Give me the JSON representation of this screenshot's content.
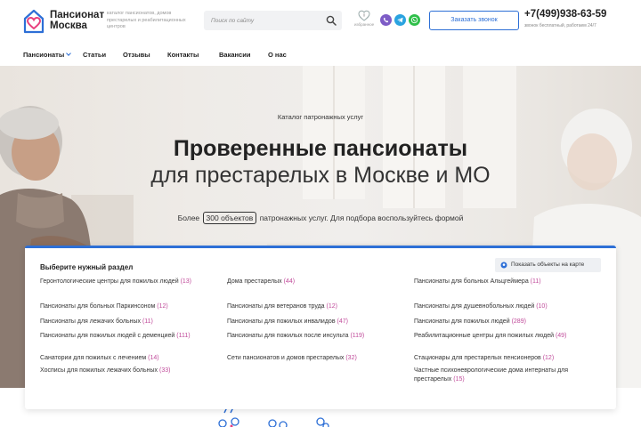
{
  "header": {
    "logo_line1": "Пансионат",
    "logo_line2": "Москва",
    "tagline": "каталог пансионатов, домов престарелых и реабилитационных центров",
    "search_placeholder": "Поиск по сайту",
    "favorites_count": "0",
    "favorites_label": "избранное",
    "callback_label": "Заказать звонок",
    "phone": "+7(499)938-63-59",
    "phone_note": "звонок бесплатный, работаем 24/7"
  },
  "nav": {
    "items": [
      "Пансионаты",
      "Статьи",
      "Отзывы",
      "Контакты",
      "Вакансии",
      "О нас"
    ]
  },
  "hero": {
    "kicker": "Каталог патронажных услуг",
    "title": "Проверенные пансионаты",
    "subtitle": "для престарелых в Москве и МО",
    "count_prefix": "Более",
    "count_box": "300 объектов",
    "count_suffix": "патронажных услуг. Для подбора воспользуйтесь формой"
  },
  "catalog": {
    "title": "Выберите нужный раздел",
    "map_button": "Показать объекты на карте",
    "columns": [
      [
        {
          "label": "Геронтологические центры для пожилых людей",
          "count": "(13)"
        },
        {
          "label": "Пансионаты для больных Паркинсоном",
          "count": "(12)"
        },
        {
          "label": "Пансионаты для лежачих больных",
          "count": "(11)"
        },
        {
          "label": "Пансионаты для пожилых людей с деменцией",
          "count": "(111)"
        },
        {
          "label": "Санатории для пожилых с лечением",
          "count": "(14)"
        },
        {
          "label": "Хосписы для пожилых лежачих больных",
          "count": "(33)"
        }
      ],
      [
        {
          "label": "Дома престарелых",
          "count": "(44)"
        },
        {
          "label": "Пансионаты для ветеранов труда",
          "count": "(12)"
        },
        {
          "label": "Пансионаты для пожилых инвалидов",
          "count": "(47)"
        },
        {
          "label": "Пансионаты для пожилых после инсульта",
          "count": "(119)"
        },
        {
          "label": "Сети пансионатов и домов престарелых",
          "count": "(32)"
        }
      ],
      [
        {
          "label": "Пансионаты для больных Альцгеймера",
          "count": "(11)"
        },
        {
          "label": "Пансионаты для душевнобольных людей",
          "count": "(10)"
        },
        {
          "label": "Пансионаты для пожилых людей",
          "count": "(289)"
        },
        {
          "label": "Реабилитационные центры для пожилых людей",
          "count": "(49)"
        },
        {
          "label": "Стационары для престарелых пенсионеров",
          "count": "(12)"
        },
        {
          "label": "Частные психоневрологические дома интернаты для престарелых",
          "count": "(15)"
        }
      ]
    ]
  },
  "colors": {
    "accent": "#2d6fd6",
    "count": "#c04a9a",
    "logo_pink": "#e8407e"
  }
}
